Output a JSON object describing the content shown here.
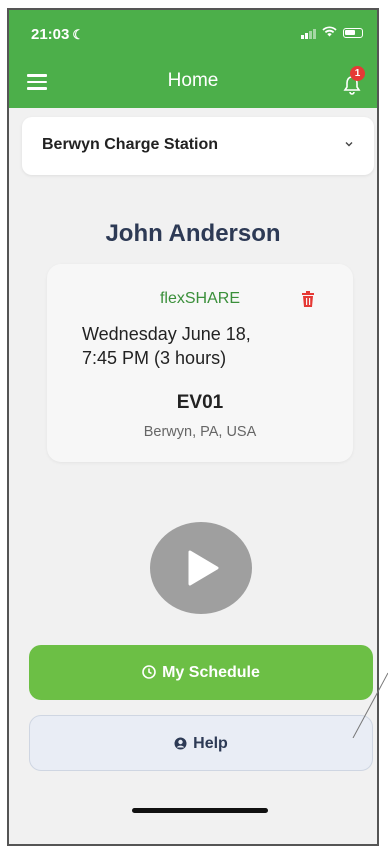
{
  "status_bar": {
    "time": "21:03"
  },
  "nav": {
    "title": "Home",
    "notification_count": "1"
  },
  "station_select": {
    "selected": "Berwyn Charge Station"
  },
  "user": {
    "name": "John Anderson"
  },
  "reservation": {
    "service": "flexSHARE",
    "date_line1": "Wednesday June 18,",
    "date_line2": "7:45 PM (3 hours)",
    "charger": "EV01",
    "location": "Berwyn, PA, USA"
  },
  "buttons": {
    "schedule": "My Schedule",
    "help": "Help"
  },
  "colors": {
    "brand_green": "#4caf4a",
    "schedule_green": "#6cbf45",
    "alert_red": "#e53935",
    "heading_navy": "#2d3a55"
  }
}
